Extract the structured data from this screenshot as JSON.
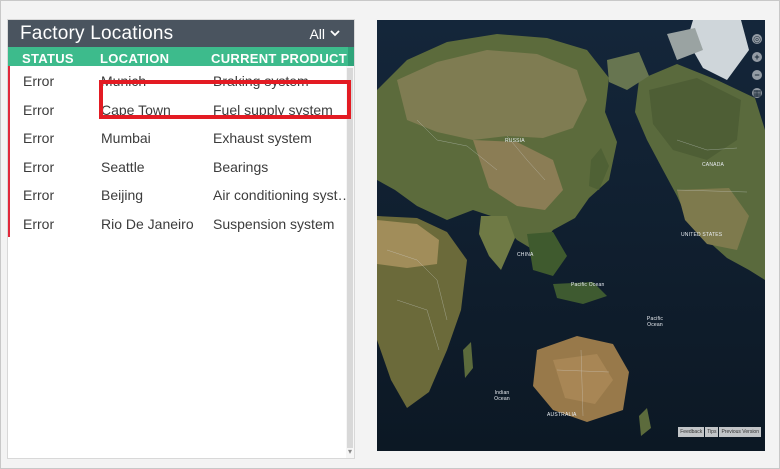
{
  "panel": {
    "title": "Factory Locations",
    "filter_label": "All",
    "columns": {
      "status": "STATUS",
      "location": "LOCATION",
      "product": "CURRENT PRODUCT"
    },
    "rows": [
      {
        "status": "Error",
        "location": "Munich",
        "product": "Braking system"
      },
      {
        "status": "Error",
        "location": "Cape Town",
        "product": "Fuel supply system"
      },
      {
        "status": "Error",
        "location": "Mumbai",
        "product": "Exhaust system"
      },
      {
        "status": "Error",
        "location": "Seattle",
        "product": "Bearings"
      },
      {
        "status": "Error",
        "location": "Beijing",
        "product": "Air conditioning system"
      },
      {
        "status": "Error",
        "location": "Rio De Janeiro",
        "product": "Suspension system"
      }
    ]
  },
  "map": {
    "labels": {
      "russia": "RUSSIA",
      "china": "CHINA",
      "canada": "CANADA",
      "united_states": "UNITED STATES",
      "australia": "AUSTRALIA",
      "pacific_ocean_1": "Pacific Ocean",
      "pacific_ocean_2": "Pacific Ocean",
      "indian_ocean": "Indian Ocean"
    },
    "footer": [
      "Feedback",
      "Tips",
      "Previous Version"
    ]
  },
  "colors": {
    "header_bg": "#4a545f",
    "column_header_bg": "#3dbb8c",
    "error_indicator": "#e0283a",
    "highlight": "#e31b23"
  }
}
